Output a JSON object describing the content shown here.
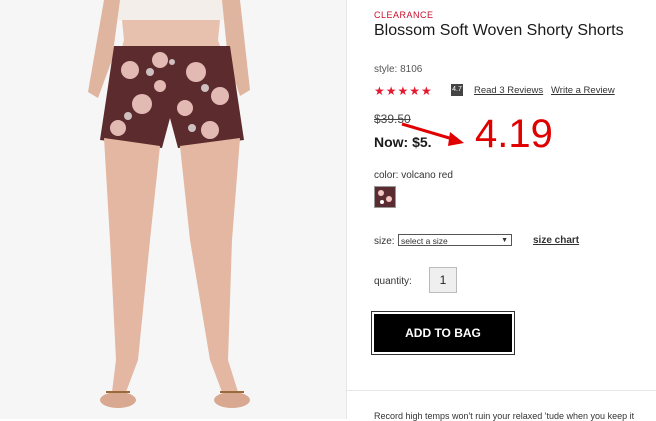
{
  "product": {
    "badge": "CLEARANCE",
    "title": "Blossom Soft Woven Shorty Shorts",
    "style": "style: 8106",
    "rating": "4.7",
    "stars": "★★★★★",
    "reviews_link": "Read 3 Reviews",
    "write_review_link": "Write a Review",
    "old_price": "$39.50",
    "now_price": "Now: $5."
  },
  "options": {
    "color_label": "color: volcano red",
    "size_label": "size:",
    "size_placeholder": "select a size",
    "size_chart": "size chart",
    "quantity_label": "quantity:",
    "quantity_value": "1"
  },
  "actions": {
    "add_to_bag": "ADD TO BAG"
  },
  "description": "Record high temps won't ruin your relaxed 'tude when you keep it",
  "annotation": {
    "value": "4.19",
    "color": "#e00000"
  },
  "colors": {
    "brand_red": "#c8102e",
    "star_red": "#e3192f",
    "button_bg": "#000000"
  }
}
